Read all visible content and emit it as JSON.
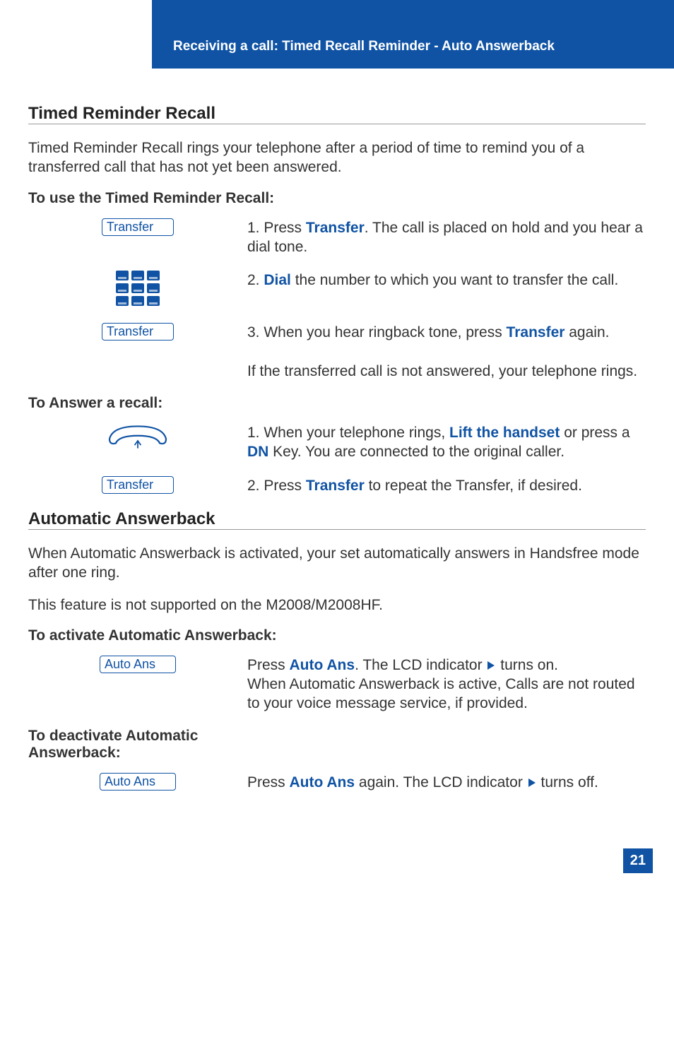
{
  "header": {
    "title": "Receiving a call: Timed Recall Reminder - Auto Answerback"
  },
  "section1": {
    "title": "Timed Reminder Recall",
    "intro": "Timed Reminder Recall rings your telephone after a period of time to remind you of a transferred call that has not yet been answered.",
    "sub1": "To use the Timed Reminder Recall:",
    "steps": {
      "s1_pre": "1. Press ",
      "s1_kw": "Transfer",
      "s1_post": ". The call is placed on hold and you hear a dial tone.",
      "s2_pre": "2. ",
      "s2_kw": "Dial",
      "s2_post": " the number to which you want to transfer the call.",
      "s3_pre": "3. When you hear ringback tone, press ",
      "s3_kw": "Transfer",
      "s3_post": " again.",
      "s3_note": "If the transferred call is not answered, your telephone rings."
    },
    "sub2": "To Answer a recall:",
    "recall": {
      "r1_pre": "1. When your telephone rings, ",
      "r1_kw1": "Lift the handset",
      "r1_mid": " or press a ",
      "r1_kw2": "DN",
      "r1_post": " Key. You are connected to the original caller.",
      "r2_pre": "2. Press ",
      "r2_kw": "Transfer",
      "r2_post": " to repeat the Transfer, if desired."
    },
    "buttons": {
      "transfer": "Transfer"
    }
  },
  "section2": {
    "title": "Automatic Answerback",
    "p1": "When Automatic Answerback is activated, your set automatically answers in Handsfree mode after one ring.",
    "p2": "This feature is not supported on the M2008/M2008HF.",
    "sub1": "To activate Automatic Answerback:",
    "act_pre": "Press ",
    "act_kw": "Auto Ans",
    "act_post1": ". The LCD indicator ",
    "act_post2": " turns on.",
    "act_note": "When Automatic Answerback is active, Calls are not routed to your voice message service, if provided.",
    "sub2": "To deactivate Automatic Answerback:",
    "deact_pre": "Press ",
    "deact_kw": "Auto Ans",
    "deact_post1": " again. The LCD indicator ",
    "deact_post2": " turns off.",
    "buttons": {
      "autoans": "Auto Ans"
    }
  },
  "page_number": "21"
}
